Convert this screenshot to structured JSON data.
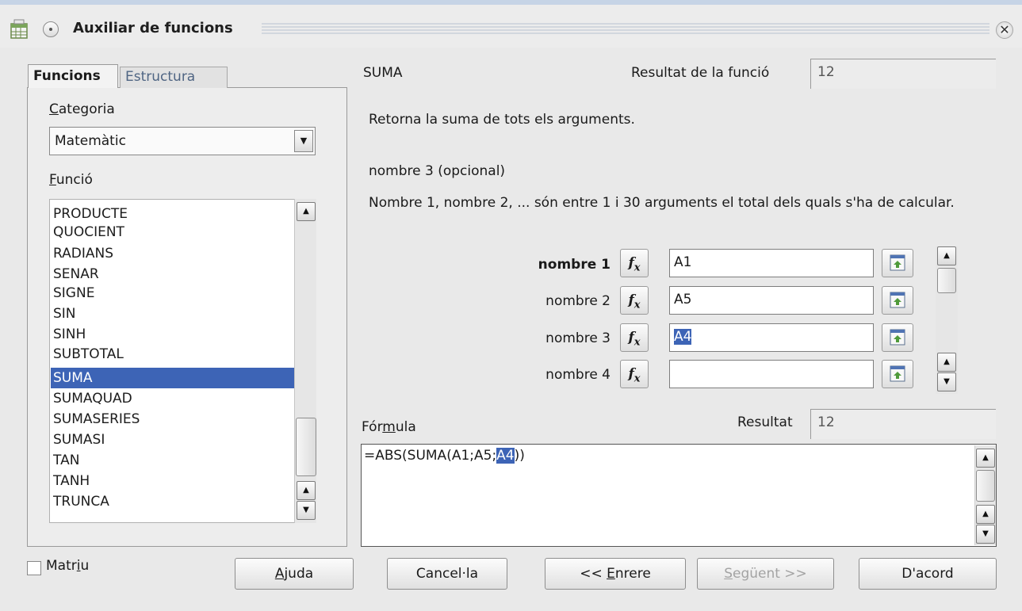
{
  "window": {
    "title": "Auxiliar de funcions"
  },
  "tabs": [
    {
      "label": "Funcions",
      "active": true
    },
    {
      "label": "Estructura",
      "active": false
    }
  ],
  "category": {
    "label": "Categoria",
    "value": "Matemàtic"
  },
  "function_list": {
    "label": "Funció",
    "items": [
      "PRODUCTE",
      "QUOCIENT",
      "RADIANS",
      "SENAR",
      "SIGNE",
      "SIN",
      "SINH",
      "SUBTOTAL",
      "SUMA",
      "SUMAQUAD",
      "SUMASERIES",
      "SUMASI",
      "TAN",
      "TANH",
      "TRUNCA"
    ],
    "selected": "SUMA"
  },
  "matrix": {
    "label": "Matriu",
    "checked": false
  },
  "function_info": {
    "name": "SUMA",
    "result_label": "Resultat de la funció",
    "result_value": "12",
    "description": "Retorna la suma de tots els arguments.",
    "arg_title": "nombre 3 (opcional)",
    "arg_description": "Nombre 1, nombre 2, ... són entre 1 i 30 arguments el total dels quals s'ha de calcular."
  },
  "arguments": [
    {
      "label": "nombre 1",
      "value": "A1",
      "bold": true
    },
    {
      "label": "nombre 2",
      "value": "A5",
      "bold": false
    },
    {
      "label": "nombre 3",
      "value": "A4",
      "bold": false,
      "selected": true
    },
    {
      "label": "nombre 4",
      "value": "",
      "bold": false
    }
  ],
  "fx_label": "fx",
  "formula": {
    "label": "Fórmula",
    "result_label": "Resultat",
    "result_value": "12",
    "text_before": "=ABS(SUMA(A1;A5;",
    "text_selected": "A4",
    "text_after": "))"
  },
  "buttons": {
    "help": "Ajuda",
    "cancel": "Cancel·la",
    "back": "<< Enrere",
    "next": "Següent >>",
    "ok": "D'acord"
  },
  "colors": {
    "selection": "#3d64b6"
  }
}
